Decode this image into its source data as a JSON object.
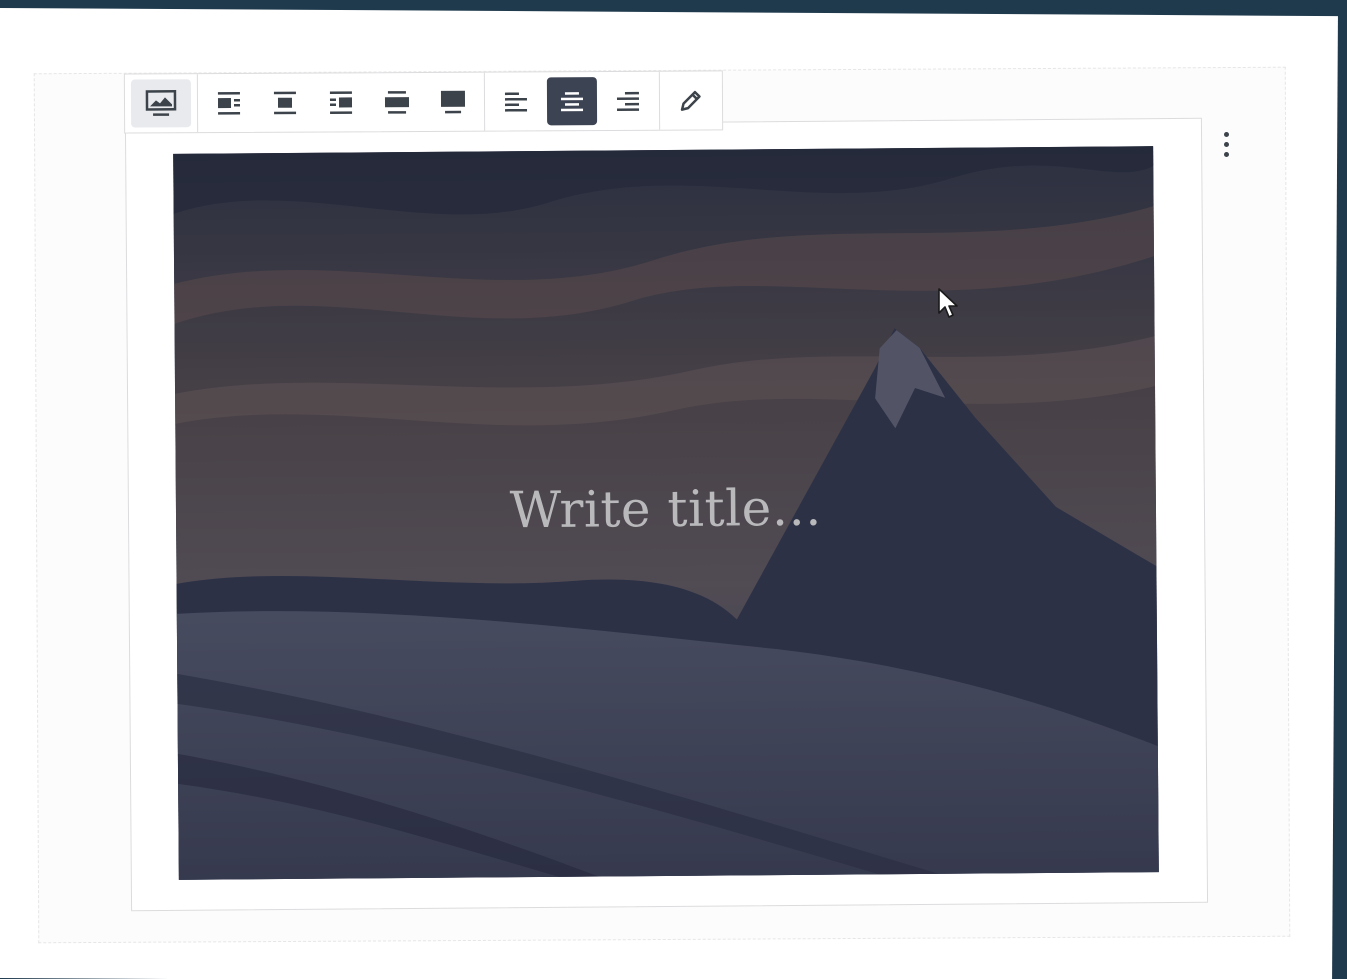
{
  "toolbar": {
    "block_type": {
      "icon": "cover-image-icon"
    },
    "layout_buttons": [
      {
        "icon": "media-left-icon"
      },
      {
        "icon": "media-center-icon"
      },
      {
        "icon": "media-right-icon"
      },
      {
        "icon": "wide-width-icon"
      },
      {
        "icon": "full-width-icon"
      }
    ],
    "align_buttons": [
      {
        "icon": "align-left-icon",
        "active": false
      },
      {
        "icon": "align-center-icon",
        "active": true
      },
      {
        "icon": "align-right-icon",
        "active": false
      }
    ],
    "edit_button": {
      "icon": "pencil-icon"
    }
  },
  "cover": {
    "title_placeholder": "Write title…"
  },
  "colors": {
    "active_button": "#3c4352",
    "icon": "#3c434a",
    "border": "#dcdcde"
  }
}
